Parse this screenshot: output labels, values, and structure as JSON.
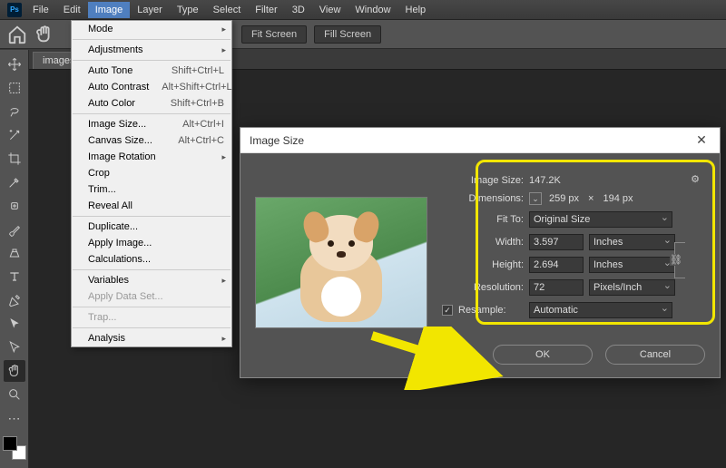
{
  "menubar": [
    "File",
    "Edit",
    "Image",
    "Layer",
    "Type",
    "Select",
    "Filter",
    "3D",
    "View",
    "Window",
    "Help"
  ],
  "optionbar": {
    "btn1": "Fit Screen",
    "btn2": "Fill Screen"
  },
  "tab_name": "images.",
  "dropdown": {
    "groups": [
      [
        {
          "label": "Mode",
          "sub": true
        }
      ],
      [
        {
          "label": "Adjustments",
          "sub": true
        }
      ],
      [
        {
          "label": "Auto Tone",
          "sc": "Shift+Ctrl+L"
        },
        {
          "label": "Auto Contrast",
          "sc": "Alt+Shift+Ctrl+L"
        },
        {
          "label": "Auto Color",
          "sc": "Shift+Ctrl+B"
        }
      ],
      [
        {
          "label": "Image Size...",
          "sc": "Alt+Ctrl+I",
          "hl": true
        },
        {
          "label": "Canvas Size...",
          "sc": "Alt+Ctrl+C"
        },
        {
          "label": "Image Rotation",
          "sub": true
        },
        {
          "label": "Crop"
        },
        {
          "label": "Trim..."
        },
        {
          "label": "Reveal All"
        }
      ],
      [
        {
          "label": "Duplicate..."
        },
        {
          "label": "Apply Image..."
        },
        {
          "label": "Calculations..."
        }
      ],
      [
        {
          "label": "Variables",
          "sub": true
        },
        {
          "label": "Apply Data Set...",
          "disabled": true
        }
      ],
      [
        {
          "label": "Trap...",
          "disabled": true
        }
      ],
      [
        {
          "label": "Analysis",
          "sub": true
        }
      ]
    ]
  },
  "dialog": {
    "title": "Image Size",
    "size_lbl": "Image Size:",
    "size_val": "147.2K",
    "dim_lbl": "Dimensions:",
    "dim_val_w": "259 px",
    "dim_times": "×",
    "dim_val_h": "194 px",
    "fit_lbl": "Fit To:",
    "fit_val": "Original Size",
    "width_lbl": "Width:",
    "width_val": "3.597",
    "width_unit": "Inches",
    "height_lbl": "Height:",
    "height_val": "2.694",
    "height_unit": "Inches",
    "res_lbl": "Resolution:",
    "res_val": "72",
    "res_unit": "Pixels/Inch",
    "resample_lbl": "Resample:",
    "resample_val": "Automatic",
    "ok": "OK",
    "cancel": "Cancel"
  },
  "tools": [
    "move",
    "artboard",
    "lasso",
    "wand",
    "crop",
    "eyedrop",
    "heal",
    "brush",
    "stamp",
    "type",
    "pen",
    "path",
    "cursor",
    "hand",
    "zoom"
  ]
}
